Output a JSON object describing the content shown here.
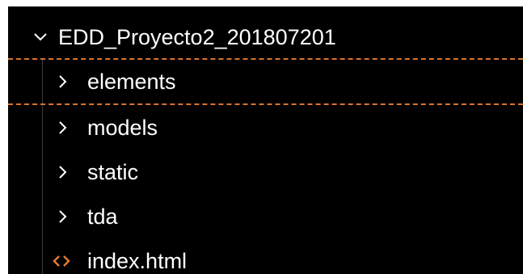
{
  "explorer": {
    "root": {
      "label": "EDD_Proyecto2_201807201",
      "icon": "chevron-down-icon"
    },
    "items": [
      {
        "label": "elements",
        "type": "folder",
        "icon": "chevron-right-icon"
      },
      {
        "label": "models",
        "type": "folder",
        "icon": "chevron-right-icon"
      },
      {
        "label": "static",
        "type": "folder",
        "icon": "chevron-right-icon"
      },
      {
        "label": "tda",
        "type": "folder",
        "icon": "chevron-right-icon"
      },
      {
        "label": "index.html",
        "type": "file",
        "icon": "html-file-icon"
      }
    ]
  },
  "colors": {
    "background": "#000000",
    "text": "#ffffff",
    "focus_dash": "#d9732f",
    "html_icon": "#e37933"
  }
}
